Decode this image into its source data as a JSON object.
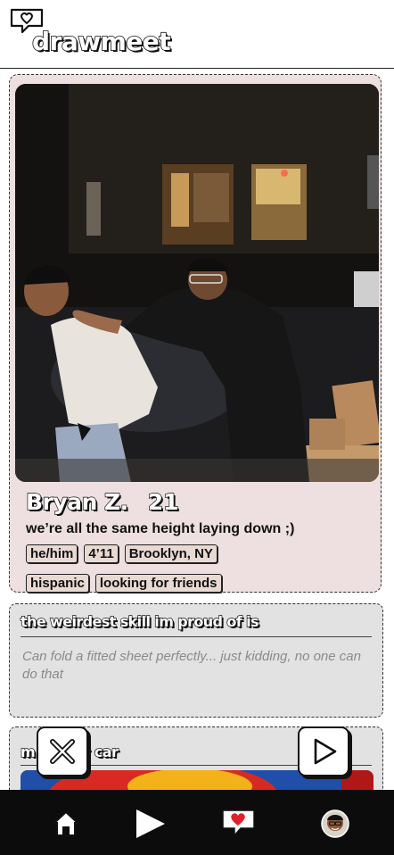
{
  "app": {
    "brand": "drawmeet"
  },
  "profile": {
    "name": "Bryan Z.",
    "age": "21",
    "tagline": "we’re all the same height laying down ;)",
    "tags": [
      "he/him",
      "4’11",
      "Brooklyn, NY",
      "hispanic",
      "looking for friends"
    ]
  },
  "prompt1": {
    "title": "the weirdest skill im proud of is",
    "answer": "Can fold a fitted sheet perfectly... just kidding, no one can do that"
  },
  "prompt2": {
    "title_left": "m",
    "title_right": "y car"
  },
  "actions": {
    "pass_icon": "x-icon",
    "play_icon": "play-icon"
  },
  "nav": {
    "items": [
      "home-icon",
      "play-icon",
      "heart-chat-icon",
      "profile-avatar"
    ]
  },
  "colors": {
    "card_bg": "#eee0e0",
    "prompt_bg": "#e2e2e2",
    "nav_bg": "#0c0c0c",
    "heart": "#e0202a"
  }
}
